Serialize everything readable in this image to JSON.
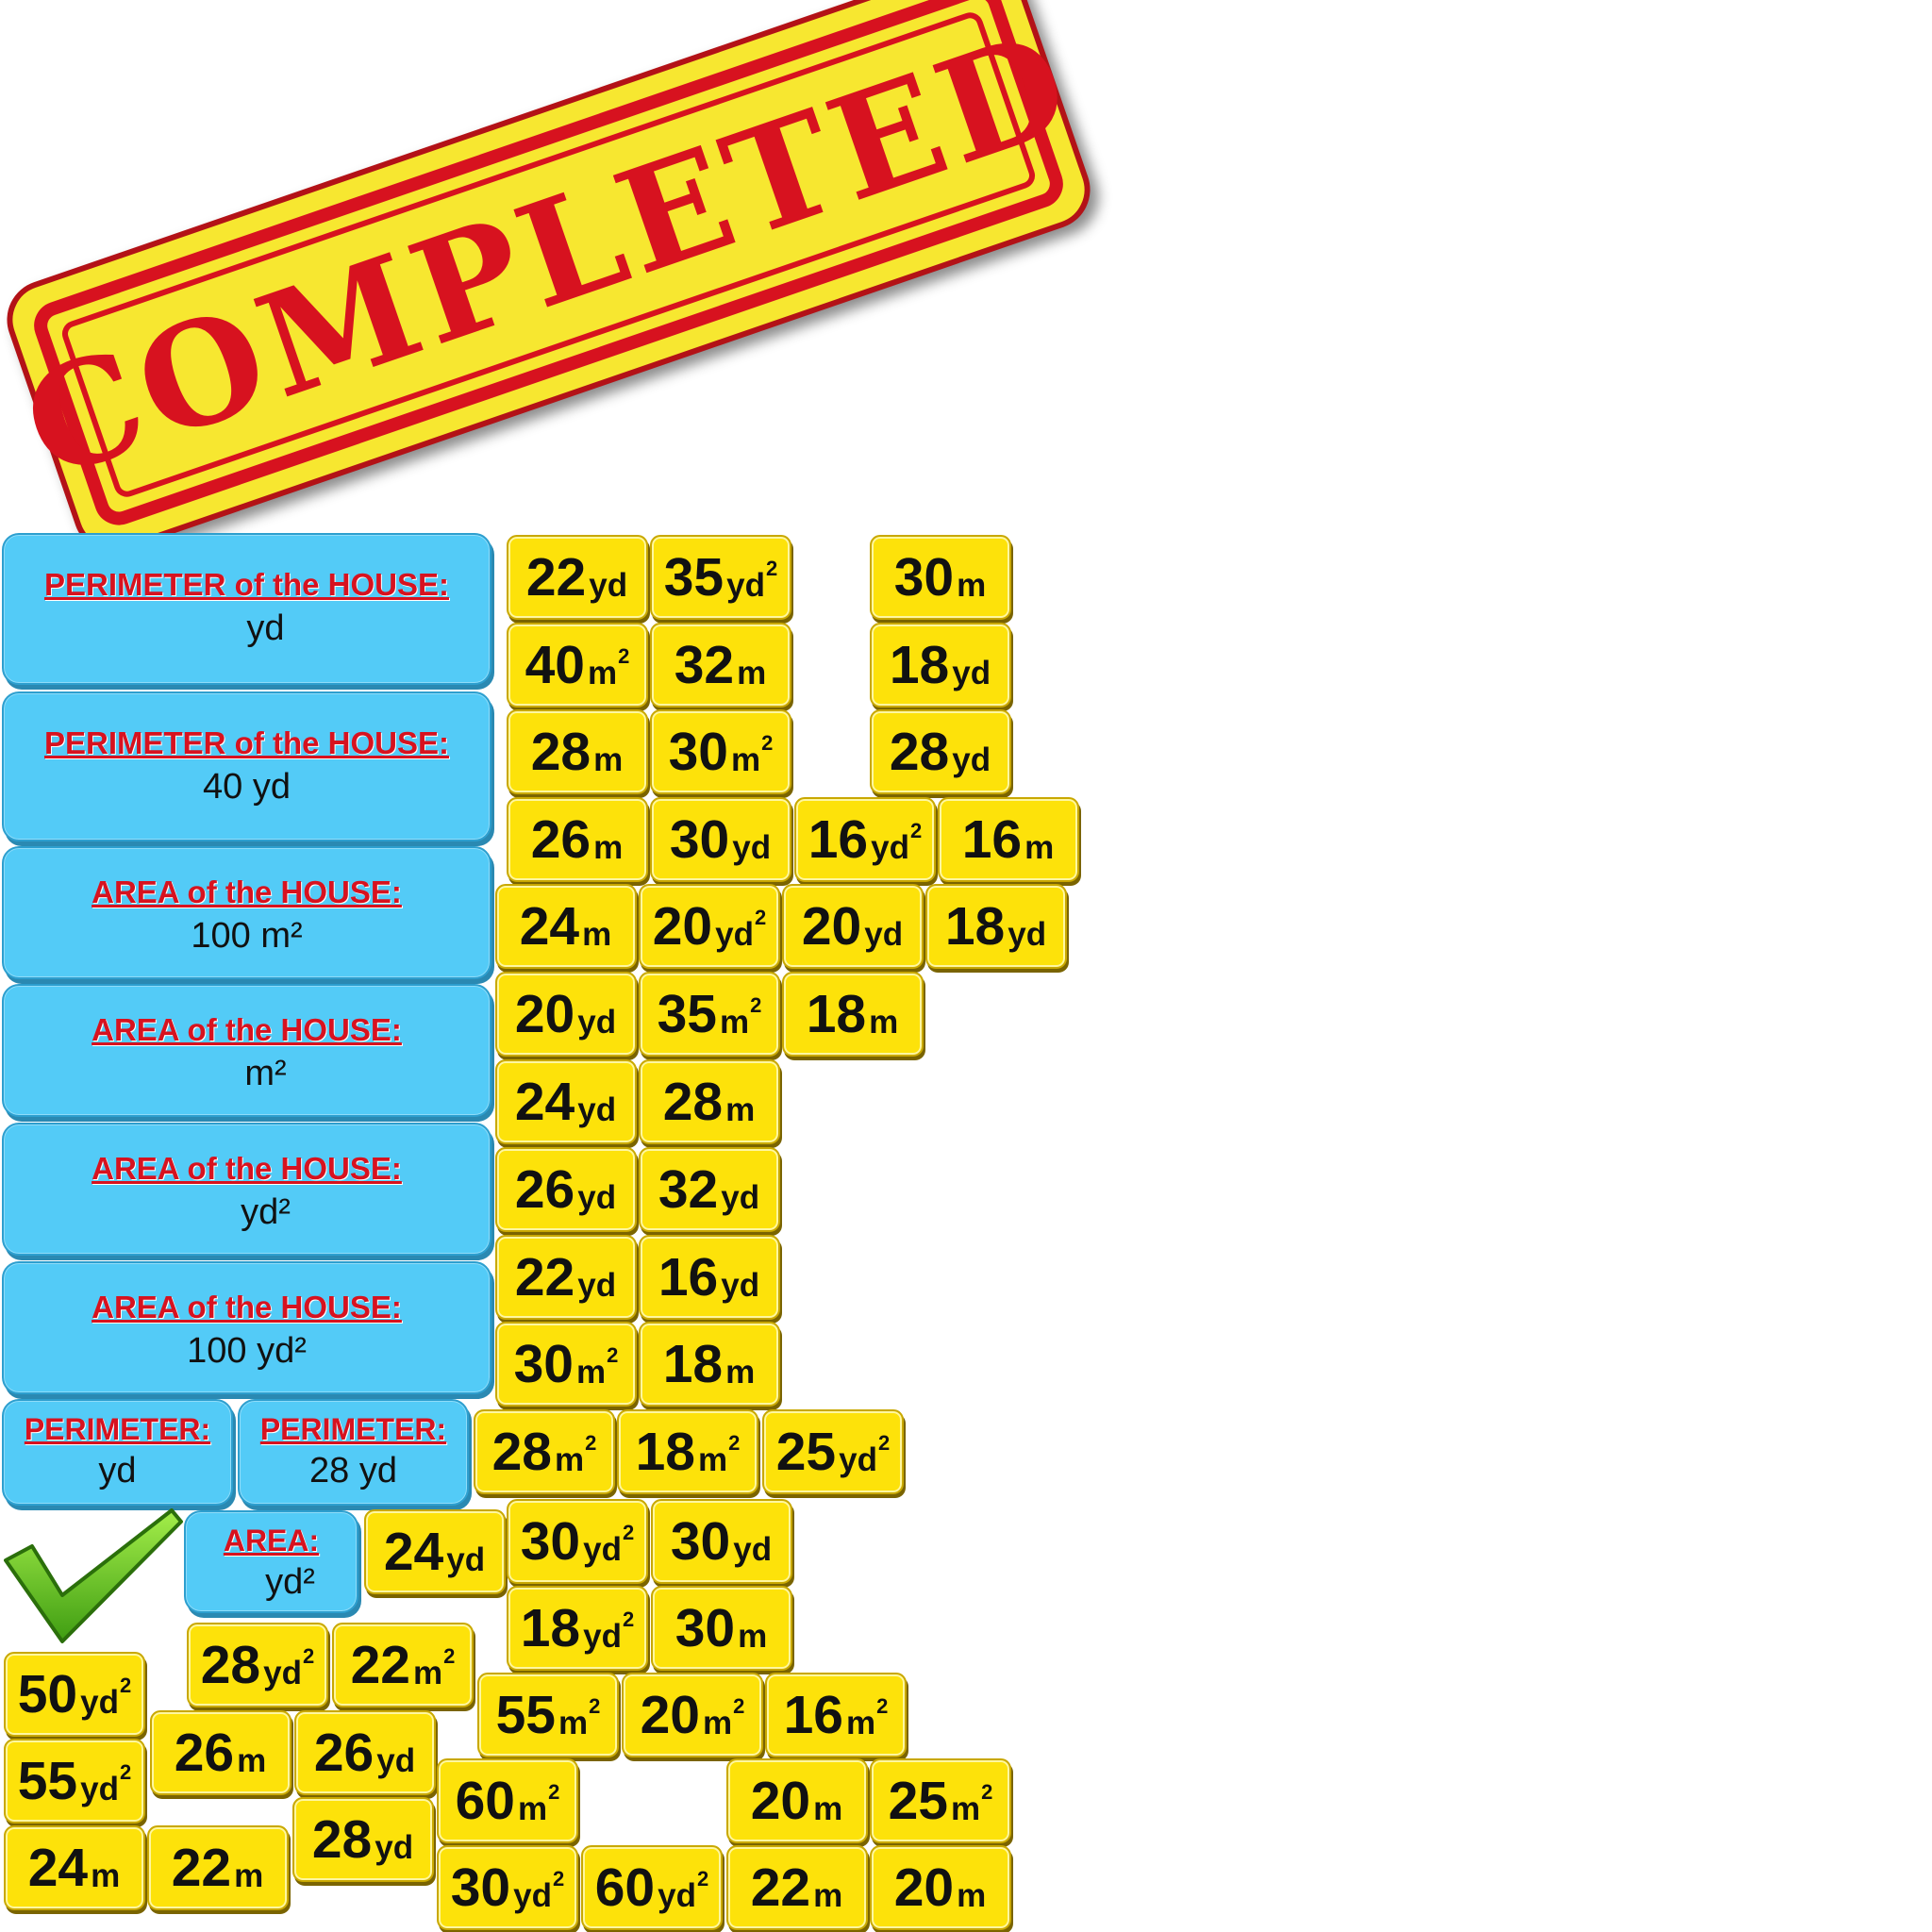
{
  "stamp": {
    "text": "COMPLETED"
  },
  "panels": [
    {
      "title": "PERIMETER of the HOUSE:",
      "value": "yd"
    },
    {
      "title": "PERIMETER of the HOUSE:",
      "value": "40 yd"
    },
    {
      "title": "AREA of the HOUSE:",
      "value": "100 m²"
    },
    {
      "title": "AREA of the HOUSE:",
      "value": "m²"
    },
    {
      "title": "AREA of the HOUSE:",
      "value": "yd²"
    },
    {
      "title": "AREA of the HOUSE:",
      "value": "100 yd²"
    },
    {
      "title": "PERIMETER:",
      "value": "yd"
    },
    {
      "title": "PERIMETER:",
      "value": "28 yd"
    },
    {
      "title": "AREA:",
      "value": "yd²"
    }
  ],
  "tiles": [
    {
      "num": "22",
      "unit": "yd",
      "sq": ""
    },
    {
      "num": "35",
      "unit": "yd",
      "sq": "2"
    },
    {
      "num": "30",
      "unit": "m",
      "sq": ""
    },
    {
      "num": "40",
      "unit": "m",
      "sq": "2"
    },
    {
      "num": "32",
      "unit": "m",
      "sq": ""
    },
    {
      "num": "18",
      "unit": "yd",
      "sq": ""
    },
    {
      "num": "28",
      "unit": "m",
      "sq": ""
    },
    {
      "num": "30",
      "unit": "m",
      "sq": "2"
    },
    {
      "num": "28",
      "unit": "yd",
      "sq": ""
    },
    {
      "num": "26",
      "unit": "m",
      "sq": ""
    },
    {
      "num": "30",
      "unit": "yd",
      "sq": ""
    },
    {
      "num": "16",
      "unit": "yd",
      "sq": "2"
    },
    {
      "num": "16",
      "unit": "m",
      "sq": ""
    },
    {
      "num": "24",
      "unit": "m",
      "sq": ""
    },
    {
      "num": "20",
      "unit": "yd",
      "sq": "2"
    },
    {
      "num": "20",
      "unit": "yd",
      "sq": ""
    },
    {
      "num": "18",
      "unit": "yd",
      "sq": ""
    },
    {
      "num": "20",
      "unit": "yd",
      "sq": ""
    },
    {
      "num": "35",
      "unit": "m",
      "sq": "2"
    },
    {
      "num": "18",
      "unit": "m",
      "sq": ""
    },
    {
      "num": "24",
      "unit": "yd",
      "sq": ""
    },
    {
      "num": "28",
      "unit": "m",
      "sq": ""
    },
    {
      "num": "26",
      "unit": "yd",
      "sq": ""
    },
    {
      "num": "32",
      "unit": "yd",
      "sq": ""
    },
    {
      "num": "22",
      "unit": "yd",
      "sq": ""
    },
    {
      "num": "16",
      "unit": "yd",
      "sq": ""
    },
    {
      "num": "30",
      "unit": "m",
      "sq": "2"
    },
    {
      "num": "18",
      "unit": "m",
      "sq": ""
    },
    {
      "num": "28",
      "unit": "m",
      "sq": "2"
    },
    {
      "num": "18",
      "unit": "m",
      "sq": "2"
    },
    {
      "num": "25",
      "unit": "yd",
      "sq": "2"
    },
    {
      "num": "24",
      "unit": "yd",
      "sq": ""
    },
    {
      "num": "30",
      "unit": "yd",
      "sq": "2"
    },
    {
      "num": "30",
      "unit": "yd",
      "sq": ""
    },
    {
      "num": "18",
      "unit": "yd",
      "sq": "2"
    },
    {
      "num": "30",
      "unit": "m",
      "sq": ""
    },
    {
      "num": "50",
      "unit": "yd",
      "sq": "2"
    },
    {
      "num": "28",
      "unit": "yd",
      "sq": "2"
    },
    {
      "num": "22",
      "unit": "m",
      "sq": "2"
    },
    {
      "num": "55",
      "unit": "m",
      "sq": "2"
    },
    {
      "num": "20",
      "unit": "m",
      "sq": "2"
    },
    {
      "num": "16",
      "unit": "m",
      "sq": "2"
    },
    {
      "num": "55",
      "unit": "yd",
      "sq": "2"
    },
    {
      "num": "26",
      "unit": "m",
      "sq": ""
    },
    {
      "num": "26",
      "unit": "yd",
      "sq": ""
    },
    {
      "num": "60",
      "unit": "m",
      "sq": "2"
    },
    {
      "num": "20",
      "unit": "m",
      "sq": ""
    },
    {
      "num": "25",
      "unit": "m",
      "sq": "2"
    },
    {
      "num": "24",
      "unit": "m",
      "sq": ""
    },
    {
      "num": "22",
      "unit": "m",
      "sq": ""
    },
    {
      "num": "28",
      "unit": "yd",
      "sq": ""
    },
    {
      "num": "30",
      "unit": "yd",
      "sq": "2"
    },
    {
      "num": "60",
      "unit": "yd",
      "sq": "2"
    },
    {
      "num": "22",
      "unit": "m",
      "sq": ""
    },
    {
      "num": "20",
      "unit": "m",
      "sq": ""
    }
  ],
  "colors": {
    "panel": "#53cbf7",
    "tile": "#fde20a",
    "title_red": "#d7121f",
    "stamp_bg": "#f7e730"
  },
  "icons": {
    "checkmark": "green-checkmark-icon"
  }
}
